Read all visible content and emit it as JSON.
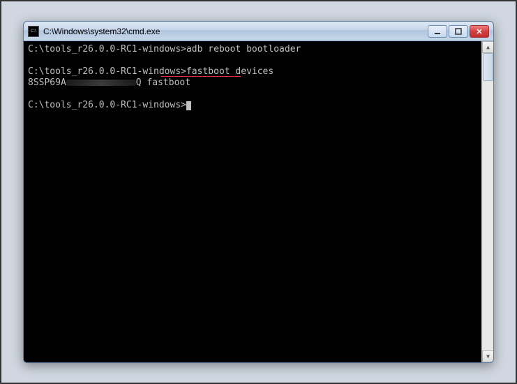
{
  "window": {
    "title": "C:\\Windows\\system32\\cmd.exe"
  },
  "terminal": {
    "lines": [
      {
        "prompt": "C:\\tools_r26.0.0-RC1-windows>",
        "command": "adb reboot bootloader"
      },
      {
        "blank": true
      },
      {
        "prompt": "C:\\tools_r26.0.0-RC1-windows>",
        "command": "fastboot devices",
        "underlined": true
      },
      {
        "device_prefix": "8SSP69A",
        "device_redacted": true,
        "device_suffix": "Q",
        "status": "fastboot"
      },
      {
        "blank": true
      },
      {
        "prompt": "C:\\tools_r26.0.0-RC1-windows>",
        "command": "",
        "cursor": true
      }
    ]
  },
  "annotation": {
    "underline_color": "#e03030"
  }
}
